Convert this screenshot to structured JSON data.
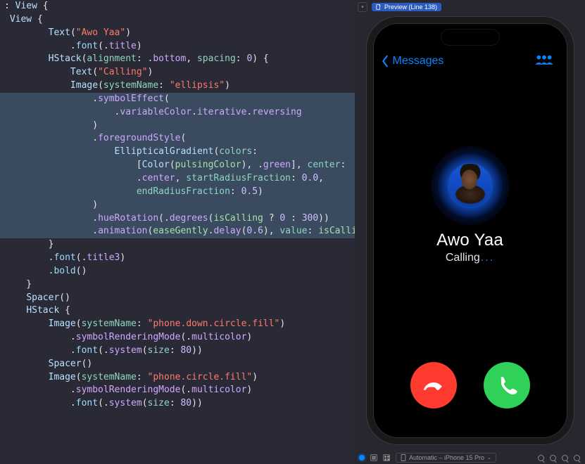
{
  "code": {
    "lines": [
      {
        "hl": false,
        "segs": [
          [
            ": ",
            "plain"
          ],
          [
            "View",
            "pale"
          ],
          [
            " {",
            "plain"
          ]
        ]
      },
      {
        "hl": false,
        "segs": [
          [
            " ",
            "plain"
          ],
          [
            "View",
            "pale"
          ],
          [
            " {",
            "plain"
          ]
        ]
      },
      {
        "hl": false,
        "segs": [
          [
            "",
            ""
          ]
        ]
      },
      {
        "hl": false,
        "segs": [
          [
            "        ",
            "plain"
          ],
          [
            "Text",
            "type"
          ],
          [
            "(",
            "plain"
          ],
          [
            "\"Awo Yaa\"",
            "str"
          ],
          [
            ")",
            "plain"
          ]
        ]
      },
      {
        "hl": false,
        "segs": [
          [
            "            .",
            "plain"
          ],
          [
            "font",
            "mod"
          ],
          [
            "(.",
            "plain"
          ],
          [
            "title",
            "prop"
          ],
          [
            ")",
            "plain"
          ]
        ]
      },
      {
        "hl": false,
        "segs": [
          [
            "",
            ""
          ]
        ]
      },
      {
        "hl": false,
        "segs": [
          [
            "        ",
            "plain"
          ],
          [
            "HStack",
            "type"
          ],
          [
            "(",
            "plain"
          ],
          [
            "alignment",
            "arg"
          ],
          [
            ": .",
            "plain"
          ],
          [
            "bottom",
            "prop"
          ],
          [
            ", ",
            "plain"
          ],
          [
            "spacing",
            "arg"
          ],
          [
            ": ",
            "plain"
          ],
          [
            "0",
            "num"
          ],
          [
            ") {",
            "plain"
          ]
        ]
      },
      {
        "hl": false,
        "segs": [
          [
            "            ",
            "plain"
          ],
          [
            "Text",
            "type"
          ],
          [
            "(",
            "plain"
          ],
          [
            "\"Calling\"",
            "str"
          ],
          [
            ")",
            "plain"
          ]
        ]
      },
      {
        "hl": false,
        "segs": [
          [
            "            ",
            "plain"
          ],
          [
            "Image",
            "type"
          ],
          [
            "(",
            "plain"
          ],
          [
            "systemName",
            "arg"
          ],
          [
            ": ",
            "plain"
          ],
          [
            "\"ellipsis\"",
            "str"
          ],
          [
            ")",
            "plain"
          ]
        ]
      },
      {
        "hl": true,
        "segs": [
          [
            "                .",
            "plain"
          ],
          [
            "symbolEffect",
            "prop"
          ],
          [
            "(",
            "plain"
          ]
        ]
      },
      {
        "hl": true,
        "segs": [
          [
            "                    .",
            "plain"
          ],
          [
            "variableColor",
            "prop"
          ],
          [
            ".",
            "plain"
          ],
          [
            "iterative",
            "prop"
          ],
          [
            ".",
            "plain"
          ],
          [
            "reversing",
            "prop"
          ]
        ]
      },
      {
        "hl": true,
        "segs": [
          [
            "                )",
            "plain"
          ]
        ]
      },
      {
        "hl": true,
        "segs": [
          [
            "                .",
            "plain"
          ],
          [
            "foregroundStyle",
            "prop"
          ],
          [
            "(",
            "plain"
          ]
        ]
      },
      {
        "hl": true,
        "segs": [
          [
            "                    ",
            "plain"
          ],
          [
            "EllipticalGradient",
            "type"
          ],
          [
            "(",
            "plain"
          ],
          [
            "colors",
            "arg"
          ],
          [
            ":",
            "plain"
          ]
        ]
      },
      {
        "hl": true,
        "segs": [
          [
            "                        [",
            "plain"
          ],
          [
            "Color",
            "type"
          ],
          [
            "(",
            "plain"
          ],
          [
            "pulsingColor",
            "id"
          ],
          [
            "), .",
            "plain"
          ],
          [
            "green",
            "prop"
          ],
          [
            "], ",
            "plain"
          ],
          [
            "center",
            "arg"
          ],
          [
            ":",
            "plain"
          ]
        ]
      },
      {
        "hl": true,
        "segs": [
          [
            "                        .",
            "plain"
          ],
          [
            "center",
            "prop"
          ],
          [
            ", ",
            "plain"
          ],
          [
            "startRadiusFraction",
            "arg"
          ],
          [
            ": ",
            "plain"
          ],
          [
            "0.0",
            "num"
          ],
          [
            ",",
            "plain"
          ]
        ]
      },
      {
        "hl": true,
        "segs": [
          [
            "                        ",
            "plain"
          ],
          [
            "endRadiusFraction",
            "arg"
          ],
          [
            ": ",
            "plain"
          ],
          [
            "0.5",
            "num"
          ],
          [
            ")",
            "plain"
          ]
        ]
      },
      {
        "hl": true,
        "segs": [
          [
            "                )",
            "plain"
          ]
        ]
      },
      {
        "hl": true,
        "segs": [
          [
            "                .",
            "plain"
          ],
          [
            "hueRotation",
            "prop"
          ],
          [
            "(.",
            "plain"
          ],
          [
            "degrees",
            "prop"
          ],
          [
            "(",
            "plain"
          ],
          [
            "isCalling",
            "id"
          ],
          [
            " ? ",
            "plain"
          ],
          [
            "0",
            "num"
          ],
          [
            " : ",
            "plain"
          ],
          [
            "300",
            "num"
          ],
          [
            "))",
            "plain"
          ]
        ]
      },
      {
        "hl": true,
        "segs": [
          [
            "                .",
            "plain"
          ],
          [
            "animation",
            "prop"
          ],
          [
            "(",
            "plain"
          ],
          [
            "easeGently",
            "id"
          ],
          [
            ".",
            "plain"
          ],
          [
            "delay",
            "prop"
          ],
          [
            "(",
            "plain"
          ],
          [
            "0.6",
            "num"
          ],
          [
            "), ",
            "plain"
          ],
          [
            "value",
            "arg"
          ],
          [
            ": ",
            "plain"
          ],
          [
            "isCalling",
            "id"
          ],
          [
            ")",
            "plain"
          ]
        ]
      },
      {
        "hl": false,
        "segs": [
          [
            "        }",
            "plain"
          ]
        ]
      },
      {
        "hl": false,
        "segs": [
          [
            "        .",
            "plain"
          ],
          [
            "font",
            "mod"
          ],
          [
            "(.",
            "plain"
          ],
          [
            "title3",
            "prop"
          ],
          [
            ")",
            "plain"
          ]
        ]
      },
      {
        "hl": false,
        "segs": [
          [
            "        .",
            "plain"
          ],
          [
            "bold",
            "mod"
          ],
          [
            "()",
            "plain"
          ]
        ]
      },
      {
        "hl": false,
        "segs": [
          [
            "",
            ""
          ]
        ]
      },
      {
        "hl": false,
        "segs": [
          [
            "    }",
            "plain"
          ]
        ]
      },
      {
        "hl": false,
        "segs": [
          [
            "",
            ""
          ]
        ]
      },
      {
        "hl": false,
        "segs": [
          [
            "    ",
            "plain"
          ],
          [
            "Spacer",
            "type"
          ],
          [
            "()",
            "plain"
          ]
        ]
      },
      {
        "hl": false,
        "segs": [
          [
            "",
            ""
          ]
        ]
      },
      {
        "hl": false,
        "segs": [
          [
            "    ",
            "plain"
          ],
          [
            "HStack",
            "type"
          ],
          [
            " {",
            "plain"
          ]
        ]
      },
      {
        "hl": false,
        "segs": [
          [
            "        ",
            "plain"
          ],
          [
            "Image",
            "type"
          ],
          [
            "(",
            "plain"
          ],
          [
            "systemName",
            "arg"
          ],
          [
            ": ",
            "plain"
          ],
          [
            "\"phone.down.circle.fill\"",
            "str"
          ],
          [
            ")",
            "plain"
          ]
        ]
      },
      {
        "hl": false,
        "segs": [
          [
            "            .",
            "plain"
          ],
          [
            "symbolRenderingMode",
            "prop"
          ],
          [
            "(.",
            "plain"
          ],
          [
            "multicolor",
            "prop"
          ],
          [
            ")",
            "plain"
          ]
        ]
      },
      {
        "hl": false,
        "segs": [
          [
            "            .",
            "plain"
          ],
          [
            "font",
            "mod"
          ],
          [
            "(.",
            "plain"
          ],
          [
            "system",
            "prop"
          ],
          [
            "(",
            "plain"
          ],
          [
            "size",
            "arg"
          ],
          [
            ": ",
            "plain"
          ],
          [
            "80",
            "num"
          ],
          [
            "))",
            "plain"
          ]
        ]
      },
      {
        "hl": false,
        "segs": [
          [
            "",
            ""
          ]
        ]
      },
      {
        "hl": false,
        "segs": [
          [
            "        ",
            "plain"
          ],
          [
            "Spacer",
            "type"
          ],
          [
            "()",
            "plain"
          ]
        ]
      },
      {
        "hl": false,
        "segs": [
          [
            "",
            ""
          ]
        ]
      },
      {
        "hl": false,
        "segs": [
          [
            "        ",
            "plain"
          ],
          [
            "Image",
            "type"
          ],
          [
            "(",
            "plain"
          ],
          [
            "systemName",
            "arg"
          ],
          [
            ": ",
            "plain"
          ],
          [
            "\"phone.circle.fill\"",
            "str"
          ],
          [
            ")",
            "plain"
          ]
        ]
      },
      {
        "hl": false,
        "segs": [
          [
            "            .",
            "plain"
          ],
          [
            "symbolRenderingMode",
            "prop"
          ],
          [
            "(.",
            "plain"
          ],
          [
            "multicolor",
            "prop"
          ],
          [
            ")",
            "plain"
          ]
        ]
      },
      {
        "hl": false,
        "segs": [
          [
            "            .",
            "plain"
          ],
          [
            "font",
            "mod"
          ],
          [
            "(.",
            "plain"
          ],
          [
            "system",
            "prop"
          ],
          [
            "(",
            "plain"
          ],
          [
            "size",
            "arg"
          ],
          [
            ": ",
            "plain"
          ],
          [
            "80",
            "num"
          ],
          [
            "))",
            "plain"
          ]
        ]
      }
    ]
  },
  "preview": {
    "badge_label": "Preview (Line 138)",
    "nav_back_label": "Messages",
    "caller_name": "Awo Yaa",
    "calling_label": "Calling",
    "calling_dots": "...",
    "device_label": "Automatic – iPhone 15 Pro"
  }
}
